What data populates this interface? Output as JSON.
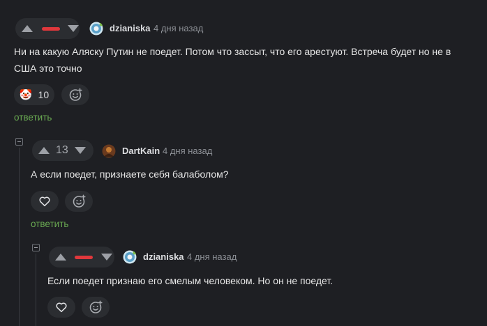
{
  "comments": [
    {
      "user": "dzianiska",
      "time": "4 дня назад",
      "text": "Ни на какую Аляску Путин не поедет. Потом что зассыт, что его арестуют. Встреча будет но не в США это точно",
      "reaction_emoji": "🤡",
      "reaction_count": "10",
      "reply": "ответить"
    },
    {
      "user": "DartKain",
      "time": "4 дня назад",
      "rating": "13",
      "text": "А если поедет, признаете себя балаболом?",
      "reply": "ответить"
    },
    {
      "user": "dzianiska",
      "time": "4 дня назад",
      "text": "Если поедет признаю его смелым человеком. Но он не поедет."
    }
  ],
  "colors": {
    "negative": "#e0383c",
    "reply": "#6aaa52",
    "background": "#1e1f23"
  },
  "icons": [
    "arrow-up-icon",
    "arrow-down-icon",
    "heart-icon",
    "add-reaction-icon",
    "collapse-icon"
  ]
}
